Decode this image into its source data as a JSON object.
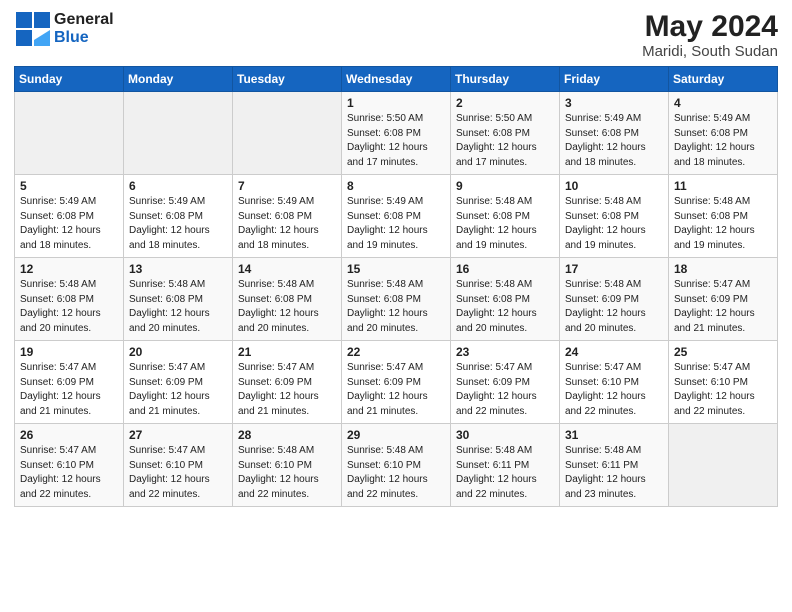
{
  "logo": {
    "general": "General",
    "blue": "Blue"
  },
  "title": "May 2024",
  "subtitle": "Maridi, South Sudan",
  "days_of_week": [
    "Sunday",
    "Monday",
    "Tuesday",
    "Wednesday",
    "Thursday",
    "Friday",
    "Saturday"
  ],
  "weeks": [
    [
      {
        "day": "",
        "info": ""
      },
      {
        "day": "",
        "info": ""
      },
      {
        "day": "",
        "info": ""
      },
      {
        "day": "1",
        "info": "Sunrise: 5:50 AM\nSunset: 6:08 PM\nDaylight: 12 hours and 17 minutes."
      },
      {
        "day": "2",
        "info": "Sunrise: 5:50 AM\nSunset: 6:08 PM\nDaylight: 12 hours and 17 minutes."
      },
      {
        "day": "3",
        "info": "Sunrise: 5:49 AM\nSunset: 6:08 PM\nDaylight: 12 hours and 18 minutes."
      },
      {
        "day": "4",
        "info": "Sunrise: 5:49 AM\nSunset: 6:08 PM\nDaylight: 12 hours and 18 minutes."
      }
    ],
    [
      {
        "day": "5",
        "info": "Sunrise: 5:49 AM\nSunset: 6:08 PM\nDaylight: 12 hours and 18 minutes."
      },
      {
        "day": "6",
        "info": "Sunrise: 5:49 AM\nSunset: 6:08 PM\nDaylight: 12 hours and 18 minutes."
      },
      {
        "day": "7",
        "info": "Sunrise: 5:49 AM\nSunset: 6:08 PM\nDaylight: 12 hours and 18 minutes."
      },
      {
        "day": "8",
        "info": "Sunrise: 5:49 AM\nSunset: 6:08 PM\nDaylight: 12 hours and 19 minutes."
      },
      {
        "day": "9",
        "info": "Sunrise: 5:48 AM\nSunset: 6:08 PM\nDaylight: 12 hours and 19 minutes."
      },
      {
        "day": "10",
        "info": "Sunrise: 5:48 AM\nSunset: 6:08 PM\nDaylight: 12 hours and 19 minutes."
      },
      {
        "day": "11",
        "info": "Sunrise: 5:48 AM\nSunset: 6:08 PM\nDaylight: 12 hours and 19 minutes."
      }
    ],
    [
      {
        "day": "12",
        "info": "Sunrise: 5:48 AM\nSunset: 6:08 PM\nDaylight: 12 hours and 20 minutes."
      },
      {
        "day": "13",
        "info": "Sunrise: 5:48 AM\nSunset: 6:08 PM\nDaylight: 12 hours and 20 minutes."
      },
      {
        "day": "14",
        "info": "Sunrise: 5:48 AM\nSunset: 6:08 PM\nDaylight: 12 hours and 20 minutes."
      },
      {
        "day": "15",
        "info": "Sunrise: 5:48 AM\nSunset: 6:08 PM\nDaylight: 12 hours and 20 minutes."
      },
      {
        "day": "16",
        "info": "Sunrise: 5:48 AM\nSunset: 6:08 PM\nDaylight: 12 hours and 20 minutes."
      },
      {
        "day": "17",
        "info": "Sunrise: 5:48 AM\nSunset: 6:09 PM\nDaylight: 12 hours and 20 minutes."
      },
      {
        "day": "18",
        "info": "Sunrise: 5:47 AM\nSunset: 6:09 PM\nDaylight: 12 hours and 21 minutes."
      }
    ],
    [
      {
        "day": "19",
        "info": "Sunrise: 5:47 AM\nSunset: 6:09 PM\nDaylight: 12 hours and 21 minutes."
      },
      {
        "day": "20",
        "info": "Sunrise: 5:47 AM\nSunset: 6:09 PM\nDaylight: 12 hours and 21 minutes."
      },
      {
        "day": "21",
        "info": "Sunrise: 5:47 AM\nSunset: 6:09 PM\nDaylight: 12 hours and 21 minutes."
      },
      {
        "day": "22",
        "info": "Sunrise: 5:47 AM\nSunset: 6:09 PM\nDaylight: 12 hours and 21 minutes."
      },
      {
        "day": "23",
        "info": "Sunrise: 5:47 AM\nSunset: 6:09 PM\nDaylight: 12 hours and 22 minutes."
      },
      {
        "day": "24",
        "info": "Sunrise: 5:47 AM\nSunset: 6:10 PM\nDaylight: 12 hours and 22 minutes."
      },
      {
        "day": "25",
        "info": "Sunrise: 5:47 AM\nSunset: 6:10 PM\nDaylight: 12 hours and 22 minutes."
      }
    ],
    [
      {
        "day": "26",
        "info": "Sunrise: 5:47 AM\nSunset: 6:10 PM\nDaylight: 12 hours and 22 minutes."
      },
      {
        "day": "27",
        "info": "Sunrise: 5:47 AM\nSunset: 6:10 PM\nDaylight: 12 hours and 22 minutes."
      },
      {
        "day": "28",
        "info": "Sunrise: 5:48 AM\nSunset: 6:10 PM\nDaylight: 12 hours and 22 minutes."
      },
      {
        "day": "29",
        "info": "Sunrise: 5:48 AM\nSunset: 6:10 PM\nDaylight: 12 hours and 22 minutes."
      },
      {
        "day": "30",
        "info": "Sunrise: 5:48 AM\nSunset: 6:11 PM\nDaylight: 12 hours and 22 minutes."
      },
      {
        "day": "31",
        "info": "Sunrise: 5:48 AM\nSunset: 6:11 PM\nDaylight: 12 hours and 23 minutes."
      },
      {
        "day": "",
        "info": ""
      }
    ]
  ],
  "colors": {
    "header_bg": "#1565c0",
    "header_text": "#ffffff",
    "accent_blue": "#1255a0"
  }
}
